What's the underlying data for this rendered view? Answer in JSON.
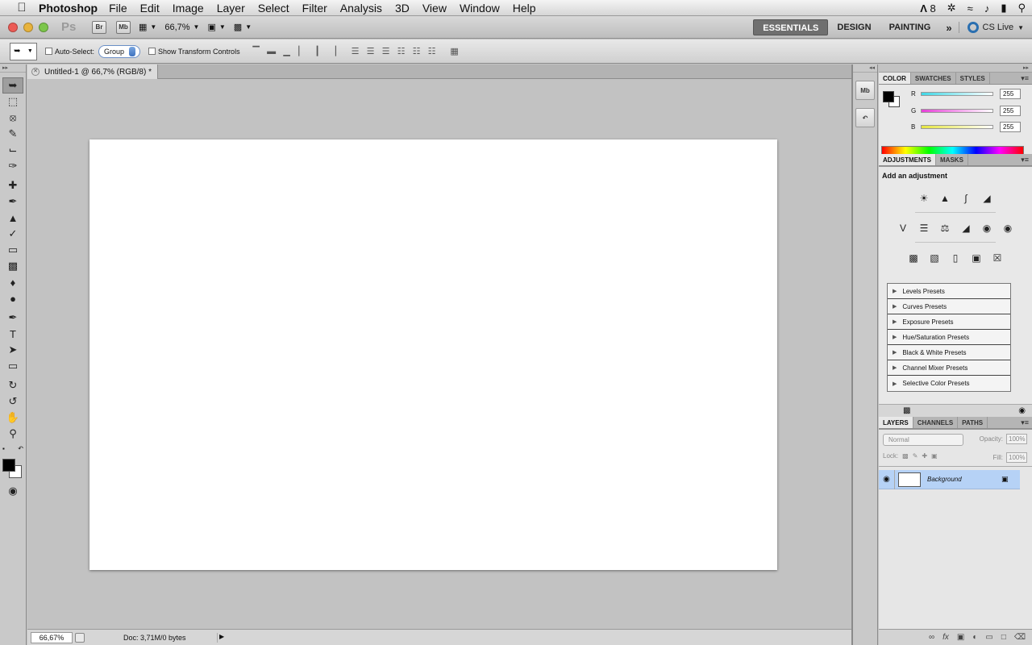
{
  "menubar": {
    "app": "Photoshop",
    "items": [
      "File",
      "Edit",
      "Image",
      "Layer",
      "Select",
      "Filter",
      "Analysis",
      "3D",
      "View",
      "Window",
      "Help"
    ],
    "status": {
      "adobe": "8"
    }
  },
  "appbar": {
    "logo": "Ps",
    "bridge": "Br",
    "minibridge": "Mb",
    "zoom": "66,7%",
    "workspaces": [
      "ESSENTIALS",
      "DESIGN",
      "PAINTING"
    ],
    "more": "»",
    "cslive": "CS Live"
  },
  "options": {
    "auto_select_label": "Auto-Select:",
    "auto_select_value": "Group",
    "transform_label": "Show Transform Controls"
  },
  "document": {
    "tab_title": "Untitled-1 @ 66,7% (RGB/8) *"
  },
  "status": {
    "zoom": "66,67%",
    "doc": "Doc: 3,71M/0 bytes"
  },
  "dock": {
    "minibridge": "Mb"
  },
  "color_panel": {
    "tabs": [
      "COLOR",
      "SWATCHES",
      "STYLES"
    ],
    "r_label": "R",
    "r_value": "255",
    "g_label": "G",
    "g_value": "255",
    "b_label": "B",
    "b_value": "255",
    "accents": {
      "r": "#3fd7e6",
      "g": "#e63fd7",
      "b": "#e6e63f"
    }
  },
  "adjustments": {
    "tabs": [
      "ADJUSTMENTS",
      "MASKS"
    ],
    "title": "Add an adjustment",
    "presets": [
      "Levels Presets",
      "Curves Presets",
      "Exposure Presets",
      "Hue/Saturation Presets",
      "Black & White Presets",
      "Channel Mixer Presets",
      "Selective Color Presets"
    ]
  },
  "layers": {
    "tabs": [
      "LAYERS",
      "CHANNELS",
      "PATHS"
    ],
    "blend": "Normal",
    "opacity_label": "Opacity:",
    "opacity": "100%",
    "lock_label": "Lock:",
    "fill_label": "Fill:",
    "fill": "100%",
    "layer_name": "Background"
  }
}
